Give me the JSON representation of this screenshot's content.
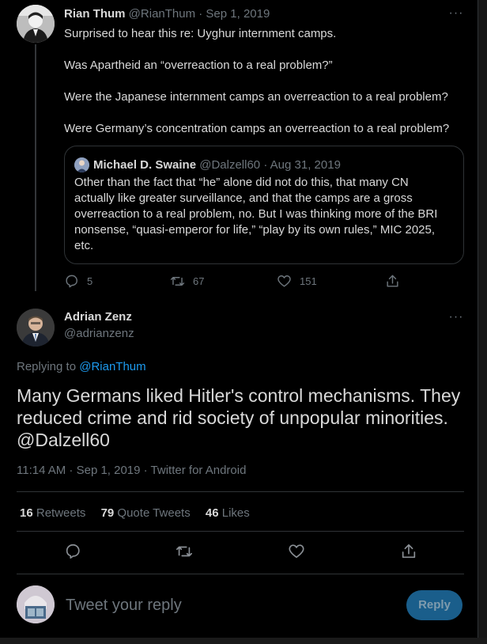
{
  "colors": {
    "background": "#000000",
    "text": "#d9d9d9",
    "muted": "#6e767d",
    "link": "#1d9bf0",
    "reply_button": "#1a5e8b"
  },
  "tweet1": {
    "name": "Rian Thum",
    "handle": "@RianThum",
    "date": "· Sep 1, 2019",
    "lines": [
      "Surprised to hear this re: Uyghur internment camps.",
      "Was Apartheid an “overreaction to a real problem?”",
      "Were the Japanese internment camps an overreaction to a real problem?",
      "Were Germany’s concentration camps an overreaction to a real problem?"
    ],
    "quote": {
      "name": "Michael D. Swaine",
      "handle": "@Dalzell60",
      "date": "· Aug 31, 2019",
      "lines": [
        "Other than the fact that “he” alone did not do this, that many CN",
        "actually like greater surveillance, and that the camps are a gross",
        "overreaction to a real problem, no. But I was thinking more of the BRI",
        "nonsense, “quasi-emperor for life,” “play by its own rules,” MIC 2025,",
        "etc."
      ]
    },
    "actions": {
      "replies": "5",
      "retweets": "67",
      "likes": "151"
    }
  },
  "tweet2": {
    "name": "Adrian Zenz",
    "handle": "@adrianzenz",
    "replying_prefix": "Replying to",
    "replying_to": "@RianThum",
    "text_lines": [
      "Many Germans liked Hitler's control mechanisms. They",
      "reduced crime and rid society of unpopular minorities."
    ],
    "mention": "@Dalzell60",
    "time": "11:14 AM · Sep 1, 2019 · Twitter for Android",
    "stats": [
      {
        "count": "16",
        "label": "Retweets"
      },
      {
        "count": "79",
        "label": "Quote Tweets"
      },
      {
        "count": "46",
        "label": "Likes"
      }
    ]
  },
  "reply_box": {
    "placeholder": "Tweet your reply",
    "button": "Reply"
  }
}
